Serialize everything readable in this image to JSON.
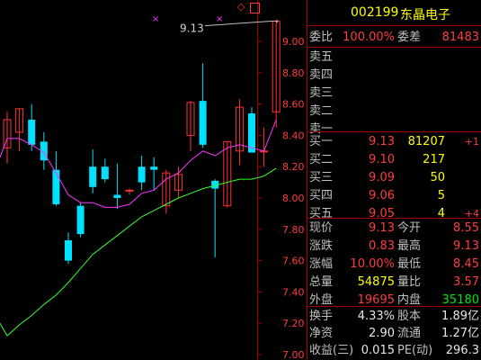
{
  "header": {
    "code": "002199",
    "name": "东晶电子"
  },
  "chart_data": {
    "type": "candlestick",
    "y_ticks": [
      "9.00",
      "8.80",
      "8.60",
      "8.40",
      "8.20",
      "8.00",
      "7.80",
      "7.60",
      "7.40",
      "7.20",
      "7.00"
    ],
    "ylim": [
      7.0,
      9.27
    ],
    "high_label": "9.13",
    "candles": [
      {
        "o": 8.32,
        "h": 8.55,
        "l": 8.22,
        "c": 8.5
      },
      {
        "o": 8.42,
        "h": 8.57,
        "l": 8.3,
        "c": 8.57
      },
      {
        "o": 8.5,
        "h": 8.6,
        "l": 8.3,
        "c": 8.34
      },
      {
        "o": 8.36,
        "h": 8.42,
        "l": 8.18,
        "c": 8.24
      },
      {
        "o": 8.18,
        "h": 8.3,
        "l": 7.95,
        "c": 7.96
      },
      {
        "o": 7.73,
        "h": 7.78,
        "l": 7.58,
        "c": 7.6
      },
      {
        "o": 7.95,
        "h": 7.97,
        "l": 7.75,
        "c": 7.77
      },
      {
        "o": 8.2,
        "h": 8.31,
        "l": 8.03,
        "c": 8.07
      },
      {
        "o": 8.2,
        "h": 8.25,
        "l": 8.1,
        "c": 8.12
      },
      {
        "o": 8.02,
        "h": 8.22,
        "l": 7.93,
        "c": 8.0
      },
      {
        "o": 8.05,
        "h": 8.06,
        "l": 8.02,
        "c": 8.05
      },
      {
        "o": 8.2,
        "h": 8.27,
        "l": 8.05,
        "c": 8.1
      },
      {
        "o": 8.2,
        "h": 8.26,
        "l": 8.05,
        "c": 8.18
      },
      {
        "o": 7.95,
        "h": 8.18,
        "l": 7.9,
        "c": 8.16
      },
      {
        "o": 8.05,
        "h": 8.2,
        "l": 8.0,
        "c": 8.15
      },
      {
        "o": 8.4,
        "h": 8.62,
        "l": 8.3,
        "c": 8.61
      },
      {
        "o": 8.62,
        "h": 8.86,
        "l": 8.32,
        "c": 8.34
      },
      {
        "o": 8.11,
        "h": 8.12,
        "l": 7.62,
        "c": 8.06
      },
      {
        "o": 7.95,
        "h": 8.36,
        "l": 7.94,
        "c": 8.36
      },
      {
        "o": 8.3,
        "h": 8.63,
        "l": 8.21,
        "c": 8.58
      },
      {
        "o": 8.54,
        "h": 8.58,
        "l": 8.29,
        "c": 8.29
      },
      {
        "o": 8.3,
        "h": 8.45,
        "l": 8.2,
        "c": 8.3
      },
      {
        "o": 8.55,
        "h": 9.13,
        "l": 8.45,
        "c": 9.13
      }
    ],
    "ma_short": [
      8.38,
      8.38,
      8.34,
      8.29,
      8.16,
      8.02,
      7.97,
      7.97,
      7.94,
      7.94,
      7.96,
      8.03,
      8.05,
      8.12,
      8.16,
      8.24,
      8.3,
      8.27,
      8.32,
      8.34,
      8.32,
      8.3,
      8.5
    ],
    "ma_long": [
      7.12,
      7.19,
      7.25,
      7.32,
      7.38,
      7.46,
      7.55,
      7.64,
      7.7,
      7.76,
      7.82,
      7.88,
      7.92,
      7.96,
      8.0,
      8.03,
      8.06,
      8.08,
      8.1,
      8.12,
      8.12,
      8.14,
      8.19
    ],
    "colors": {
      "up": "#ff3232",
      "down": "#00e0ff",
      "ma_short": "#ff33ff",
      "ma_long": "#33ff33",
      "grid": "#a00000",
      "text": "#ff3c3c"
    }
  },
  "panel": {
    "weibi": {
      "label": "委比",
      "value": "100.00%",
      "label2": "委差",
      "value2": "81483"
    },
    "sell": [
      {
        "label": "卖五"
      },
      {
        "label": "卖四"
      },
      {
        "label": "卖三"
      },
      {
        "label": "卖二"
      },
      {
        "label": "卖一"
      }
    ],
    "buy": [
      {
        "label": "买一",
        "price": "9.13",
        "vol": "81207",
        "chg": "+1"
      },
      {
        "label": "买二",
        "price": "9.10",
        "vol": "217",
        "chg": ""
      },
      {
        "label": "买三",
        "price": "9.09",
        "vol": "50",
        "chg": ""
      },
      {
        "label": "买四",
        "price": "9.06",
        "vol": "5",
        "chg": ""
      },
      {
        "label": "买五",
        "price": "9.05",
        "vol": "4",
        "chg": "+4"
      }
    ],
    "quote": [
      {
        "l1": "现价",
        "v1": "9.13",
        "l2": "今开",
        "v2": "8.55"
      },
      {
        "l1": "涨跌",
        "v1": "0.83",
        "l2": "最高",
        "v2": "9.13"
      },
      {
        "l1": "涨幅",
        "v1": "10.00%",
        "l2": "最低",
        "v2": "8.45"
      },
      {
        "l1": "总量",
        "v1": "54875",
        "l2": "量比",
        "v2": "3.57"
      },
      {
        "l1": "外盘",
        "v1": "19695",
        "l2": "内盘",
        "v2": "35180"
      }
    ],
    "stats": [
      {
        "l1": "换手",
        "v1": "4.33%",
        "l2": "股本",
        "v2": "1.89亿"
      },
      {
        "l1": "净资",
        "v1": "2.90",
        "l2": "流通",
        "v2": "1.27亿"
      },
      {
        "l1": "收益(三)",
        "v1": "0.015",
        "l2": "PE(动)",
        "v2": "296.3"
      }
    ]
  }
}
